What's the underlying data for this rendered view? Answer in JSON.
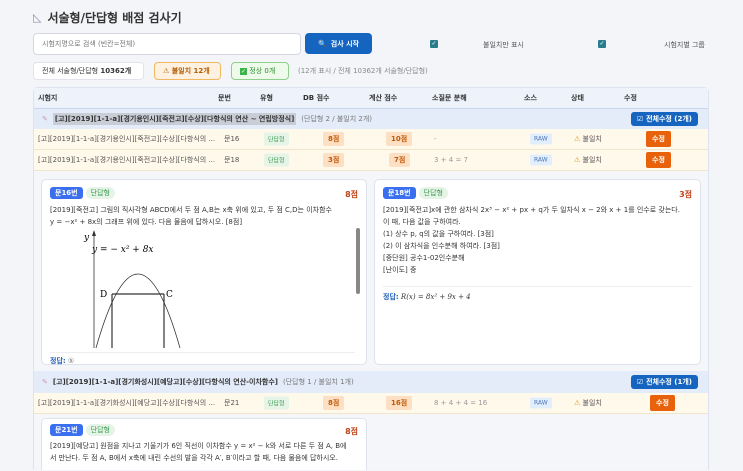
{
  "title": "서술형/단답형 배점 검사기",
  "search": {
    "placeholder": "시험지명으로 검색 (빈칸=전체)",
    "button": "검사 시작"
  },
  "options": [
    {
      "label": "불일치만 표시",
      "checked": true
    },
    {
      "label": "시험지별 그룹",
      "checked": true
    }
  ],
  "stats": {
    "total_label": "전체 서술형/단답형",
    "total": "10362개",
    "mismatch": "불일치 12개",
    "normal": "정상 0개",
    "summary": "(12개 표시 / 전체 10362개 서술형/단답형)"
  },
  "columns": [
    "시험지",
    "문번",
    "유형",
    "DB 점수",
    "계산 점수",
    "소질문 분해",
    "소스",
    "상태",
    "수정"
  ],
  "groups": [
    {
      "title": "[고][2019][1-1-a][경기용인시][죽전고][수상][다항식의 연산 ~ 연립방정식]",
      "sub": "(단답형 2 / 불일치 2개)",
      "fix_all": "전체수정 (2개)",
      "rows": [
        {
          "paper": "[고][2019][1-1-a][경기용인시][죽전고][수상][다항식의 ...",
          "num": "문16",
          "type": "단답형",
          "db": "8점",
          "calc": "10점",
          "breakdown": "-",
          "source": "RAW",
          "status": "불일치",
          "fix": "수정"
        },
        {
          "paper": "[고][2019][1-1-a][경기용인시][죽전고][수상][다항식의 ...",
          "num": "문18",
          "type": "단답형",
          "db": "3점",
          "calc": "7점",
          "breakdown": "3 + 4 = 7",
          "source": "RAW",
          "status": "불일치",
          "fix": "수정"
        }
      ],
      "cards": [
        {
          "num": "문16번",
          "type": "단답형",
          "points": "8점",
          "lines": [
            "[2019][죽전고] 그림의 직사각형 ABCD에서 두 점 A,B는 x축 위에 있고, 두 점 C,D는 이차함수",
            "y = −x² + 8x의 그래프 위에 있다. 다음 물음에 답하시오. [8점]"
          ],
          "graph_label": "y = − x² + 8x",
          "axis_y": "y",
          "pt_d": "D",
          "pt_c": "C",
          "answer_label": "정답:",
          "answer": "⑤"
        },
        {
          "num": "문18번",
          "type": "단답형",
          "points": "3점",
          "lines": [
            "[2019][죽전고]x에 관한 삼차식 2x³ − x² + px + q가 두 일차식 x − 2와 x + 1를 인수로 갖는다.",
            "이 때, 다음 값을 구하여라.",
            "(1) 상수 p, q의 값을 구하여라. [3점]",
            "(2) 이 삼차식을 인수분해 하여라. [3점]",
            "[중단원] 공수1-02인수분해",
            "[난이도] 중"
          ],
          "answer_label": "정답:",
          "answer": "R(x) = 8x² + 9x + 4"
        }
      ]
    },
    {
      "title": "[고][2019][1-1-a][경기화성시][예당고][수상][다항식의 연산-이차함수]",
      "sub": "(단답형 1 / 불일치 1개)",
      "fix_all": "전체수정 (1개)",
      "rows": [
        {
          "paper": "[고][2019][1-1-a][경기화성시][예당고][수상][다항식의 ...",
          "num": "문21",
          "type": "단답형",
          "db": "8점",
          "calc": "16점",
          "breakdown": "8 + 4 + 4 = 16",
          "source": "RAW",
          "status": "불일치",
          "fix": "수정"
        }
      ],
      "cards": [
        {
          "num": "문21번",
          "type": "단답형",
          "points": "8점",
          "lines": [
            "[2019][예당고] 원점을 지나고 기울기가 6인 직선이 이차함수 y = x² − k와 서로 다른 두 점 A, B에",
            "서 만난다. 두 점 A, B에서 x축에 내린 수선의 발을 각각 A′, B′이라고 할 때, 다음 물음에 답하시오."
          ]
        }
      ]
    }
  ]
}
